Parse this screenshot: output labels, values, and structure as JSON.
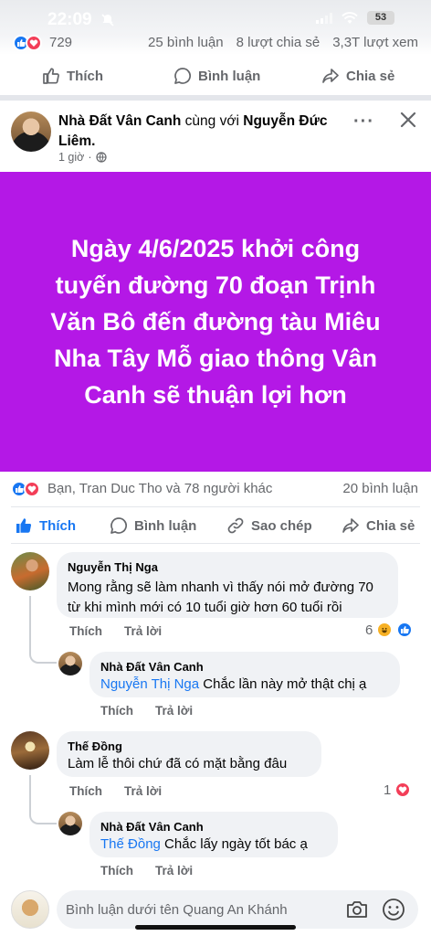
{
  "status_bar": {
    "time": "22:09",
    "battery": "53"
  },
  "previous_post": {
    "reaction_count": "729",
    "comments": "25 bình luận",
    "shares": "8 lượt chia sẻ",
    "views": "3,3T lượt xem",
    "actions": {
      "like": "Thích",
      "comment": "Bình luận",
      "share": "Chia sẻ"
    }
  },
  "post": {
    "author": "Nhà Đất Vân Canh",
    "with_text": "cùng với",
    "tagged": "Nguyễn Đức Liêm.",
    "time": "1 giờ",
    "separator": "·",
    "more_label": "···",
    "content": "Ngày 4/6/2025 khởi công tuyến đường 70 đoạn Trịnh Văn Bô đến đường tàu Miêu Nha Tây Mỗ giao thông Vân Canh sẽ thuận lợi hơn",
    "card_color": "#b418e6",
    "reactions_summary": "Bạn, Tran Duc Tho và 78 người khác",
    "comment_count": "20 bình luận",
    "actions": {
      "like": "Thích",
      "comment": "Bình luận",
      "copy": "Sao chép",
      "share": "Chia sẻ"
    }
  },
  "comments": [
    {
      "name": "Nguyễn Thị Nga",
      "text": "Mong rằng sẽ làm nhanh vì thấy nói mở đường 70 từ khi mình mới có 10 tuổi giờ hơn 60 tuổi rồi",
      "like_label": "Thích",
      "reply_label": "Trả lời",
      "reaction_count": "6",
      "reply": {
        "name": "Nhà Đất Vân Canh",
        "mention": "Nguyễn Thị Nga",
        "text": "Chắc lần này mở thật chị ạ",
        "like_label": "Thích",
        "reply_label": "Trả lời"
      }
    },
    {
      "name": "Thế Đồng",
      "text": "Làm lễ thôi chứ đã có mặt bằng đâu",
      "like_label": "Thích",
      "reply_label": "Trả lời",
      "reaction_count": "1",
      "reply": {
        "name": "Nhà Đất Vân Canh",
        "mention": "Thế Đồng",
        "text": "Chắc lấy ngày tốt bác ạ",
        "like_label": "Thích",
        "reply_label": "Trả lời"
      }
    }
  ],
  "comment_input": {
    "placeholder": "Bình luận dưới tên Quang An Khánh"
  },
  "colors": {
    "accent": "#1877f2",
    "like_blue": "#1877f2",
    "love_red": "#f33e58",
    "muted": "#65676b"
  }
}
